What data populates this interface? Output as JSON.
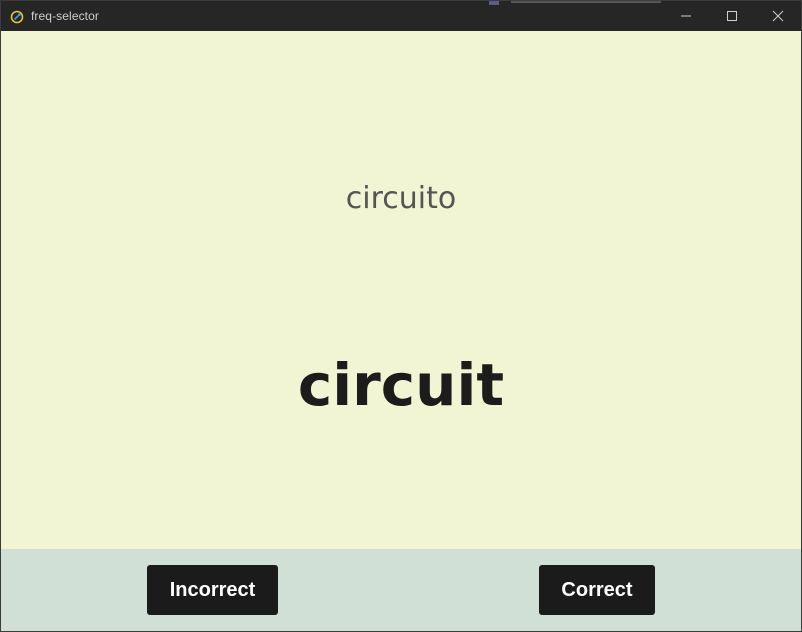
{
  "window": {
    "title": "freq-selector",
    "controls": [
      "minimize-icon",
      "maximize-icon",
      "close-icon"
    ]
  },
  "card": {
    "prompt": "circuito",
    "answer": "circuit"
  },
  "actions": {
    "incorrect_label": "Incorrect",
    "correct_label": "Correct"
  },
  "colors": {
    "card_background": "#f2f5d4",
    "footer_background": "#d1e0d6",
    "button_background": "#1b1b1b",
    "button_text": "#ffffff",
    "titlebar": "#262626"
  }
}
